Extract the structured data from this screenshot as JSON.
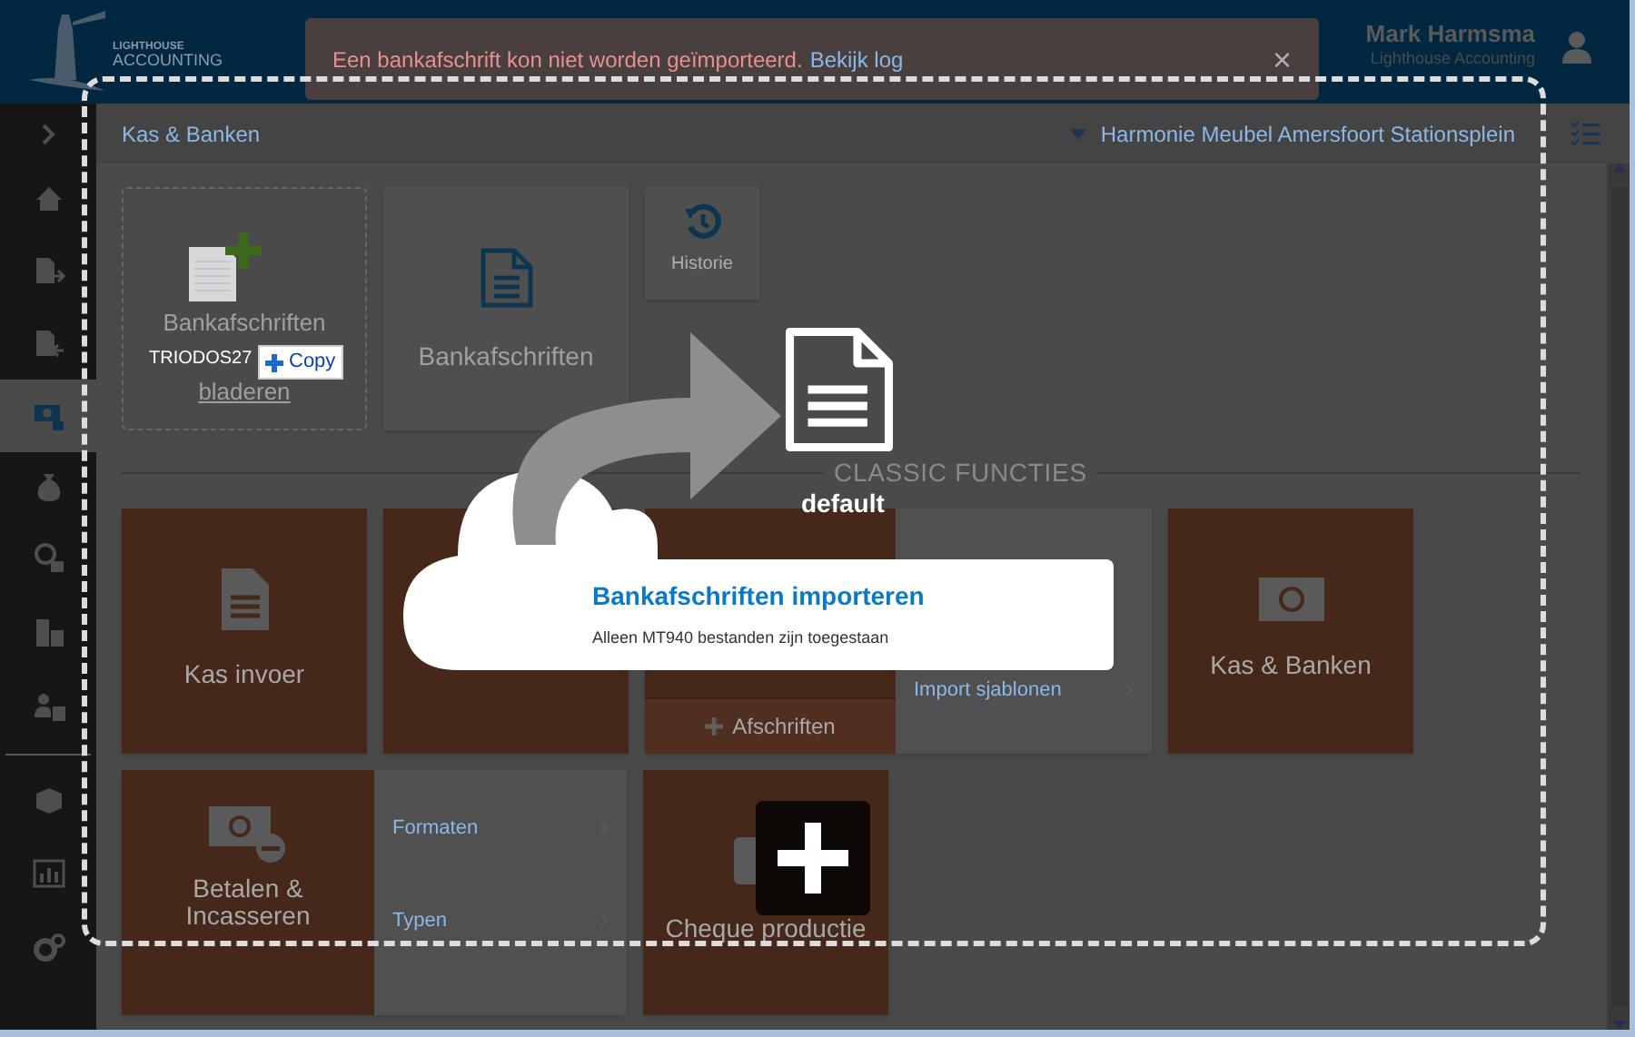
{
  "logo": {
    "line_1": "LIGHTHOUSE",
    "line_2": "ACCOUNTING"
  },
  "alert": {
    "message": "Een bankafschrift kon niet worden geïmporteerd.",
    "link": "Bekijk log",
    "close": "×"
  },
  "user": {
    "name": "Mark Harmsma",
    "company": "Lighthouse Accounting"
  },
  "sidebar": {
    "items": [
      {
        "selected": false
      },
      {
        "selected": false
      },
      {
        "selected": false
      },
      {
        "selected": false
      },
      {
        "selected": true
      },
      {
        "selected": false
      },
      {
        "selected": false
      },
      {
        "selected": false
      },
      {
        "selected": false
      },
      {
        "selected": false
      },
      {
        "selected": false
      },
      {
        "selected": false
      }
    ]
  },
  "breadcrumb": "Kas & Banken",
  "administration": "Harmonie Meubel Amersfoort Stationsplein",
  "drop_zone": {
    "text": "Bankafschriften",
    "link": "bladeren"
  },
  "top_tiles": [
    {
      "label": "Bankafschriften"
    },
    {
      "label": "Historie"
    }
  ],
  "section_heading": "CLASSIC FUNCTIES",
  "tiles": [
    {
      "kind": "tile",
      "label": "Kas invoer"
    },
    {
      "kind": "tile"
    },
    {
      "kind": "split",
      "button": "Afschriften",
      "links": [
        "Import sjablonen"
      ]
    },
    {
      "kind": "tile",
      "label": "Kas & Banken"
    },
    {
      "kind": "split",
      "label": "Betalen & Incasseren",
      "links": [
        "Formaten",
        "Typen"
      ]
    },
    {
      "kind": "tile",
      "label": "Cheque productie"
    }
  ],
  "drag": {
    "file_name": "TRIODOS27",
    "effect": "Copy"
  },
  "drop_overlay": {
    "file_label": "default",
    "title": "Bankafschriften importeren",
    "subtitle": "Alleen MT940 bestanden zijn toegestaan"
  }
}
